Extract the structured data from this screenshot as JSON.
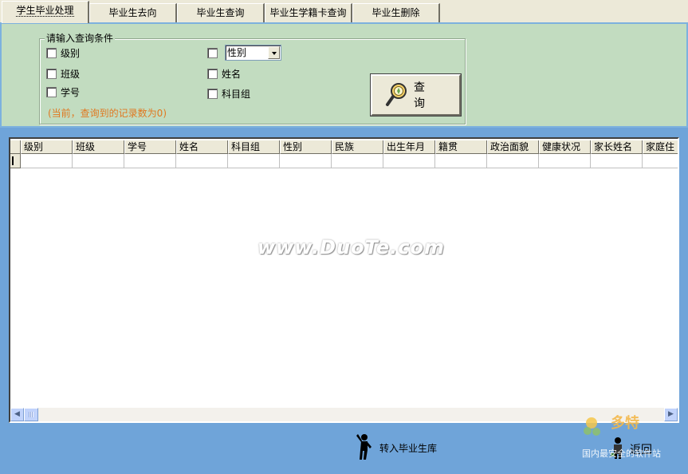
{
  "tabs": [
    {
      "label": "学生毕业处理",
      "active": true
    },
    {
      "label": "毕业生去向",
      "active": false
    },
    {
      "label": "毕业生查询",
      "active": false
    },
    {
      "label": "毕业生学籍卡查询",
      "active": false
    },
    {
      "label": "毕业生删除",
      "active": false
    }
  ],
  "query": {
    "group_title": "请输入查询条件",
    "left_options": [
      "级别",
      "班级",
      "学号"
    ],
    "right_options": [
      "姓名",
      "科目组"
    ],
    "gender_select_value": "性别",
    "hint": "(当前，查询到的记录数为0)",
    "search_button_label": "查 询"
  },
  "grid": {
    "columns": [
      "级别",
      "班级",
      "学号",
      "姓名",
      "科目组",
      "性别",
      "民族",
      "出生年月",
      "籍贯",
      "政治面貌",
      "健康状况",
      "家长姓名",
      "家庭住"
    ],
    "watermark": "www.DuoTe.com"
  },
  "bottom": {
    "transfer_label": "转入毕业生库",
    "back_label": "返回",
    "logo_text": "多特",
    "logo_sub": "国内最安全的软件站"
  },
  "colors": {
    "query_bg": "#c2dcc0",
    "frame_blue": "#6fa4d9",
    "hint_orange": "#e07820"
  }
}
